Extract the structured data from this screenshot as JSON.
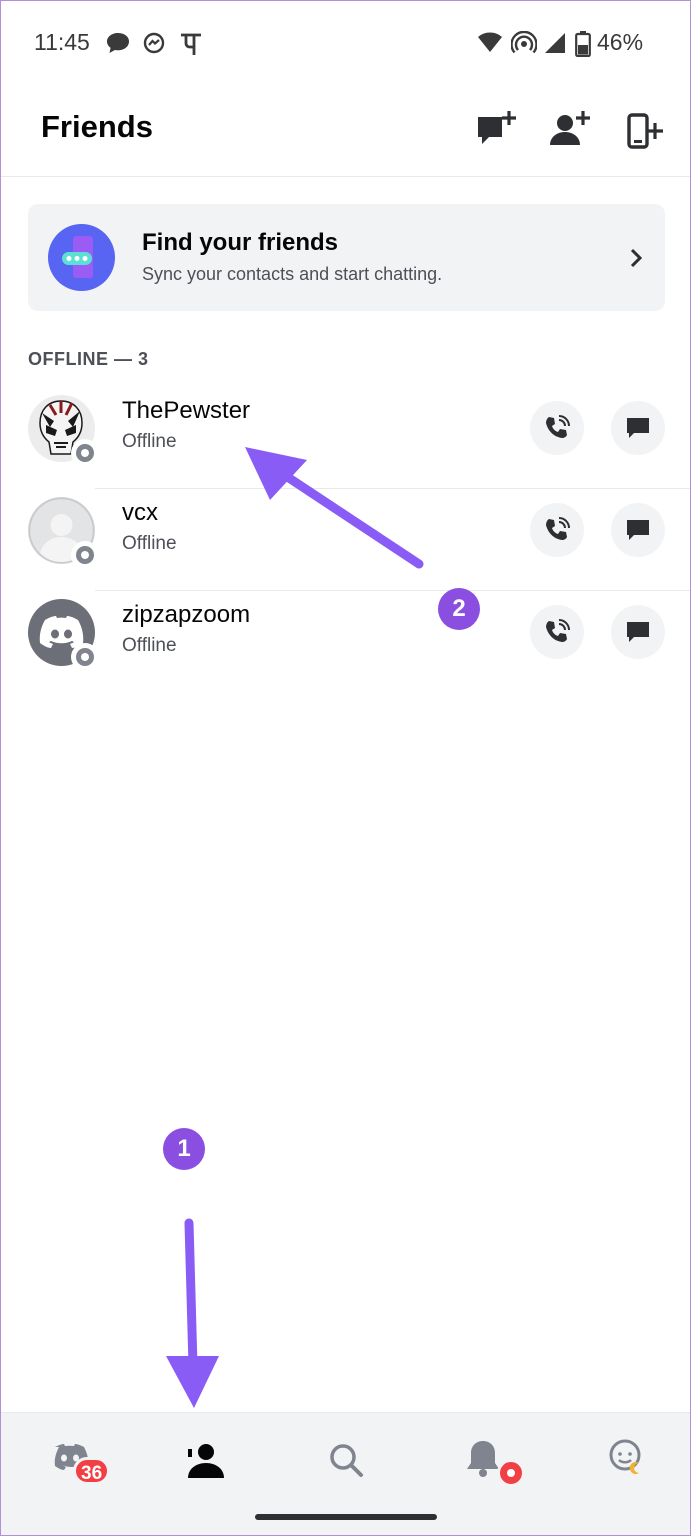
{
  "status_bar": {
    "time": "11:45",
    "battery": "46%",
    "icons": [
      "chat-bubble-icon",
      "messenger-icon",
      "devanagari-pe-icon",
      "wifi-icon",
      "hotspot-icon",
      "signal-icon",
      "battery-icon"
    ]
  },
  "header": {
    "title": "Friends",
    "actions": [
      "new-message-icon",
      "add-friend-icon",
      "contacts-sync-icon"
    ]
  },
  "find_friends": {
    "title": "Find your friends",
    "subtitle": "Sync your contacts and start chatting."
  },
  "section": {
    "heading": "OFFLINE — 3"
  },
  "friends": [
    {
      "name": "ThePewster",
      "status": "Offline",
      "avatar": "masked-skull-icon"
    },
    {
      "name": "vcx",
      "status": "Offline",
      "avatar": "default-user-icon"
    },
    {
      "name": "zipzapzoom",
      "status": "Offline",
      "avatar": "discord-logo-icon"
    }
  ],
  "markers": {
    "one": "1",
    "two": "2"
  },
  "bottom_nav": {
    "items": [
      "servers-icon",
      "friends-icon",
      "search-icon",
      "notifications-icon",
      "profile-icon"
    ],
    "servers_badge": "36"
  },
  "colors": {
    "blurple": "#5865f2",
    "marker_purple": "#8a4fe0",
    "badge_red": "#f23f43",
    "offline_gray": "#80848e"
  }
}
